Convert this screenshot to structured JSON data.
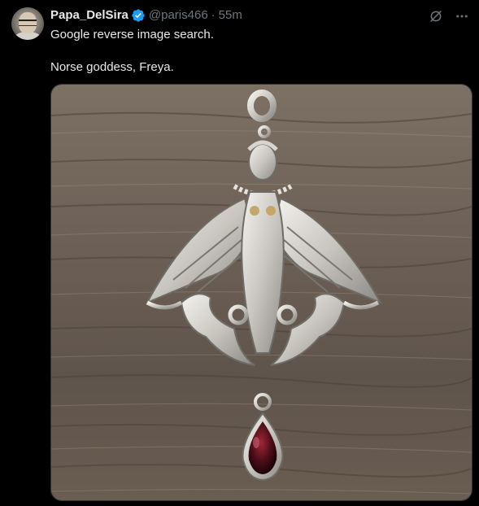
{
  "author": {
    "display_name": "Papa_DelSira",
    "handle": "@paris466",
    "separator": "·",
    "time": "55m",
    "verified": true,
    "verified_color": "#1d9bf0"
  },
  "tweet": {
    "lines": [
      "Google reverse image search.",
      "Norse goddess, Freya."
    ]
  },
  "actions": {
    "grok_icon": "grok-icon",
    "more_icon": "more-icon"
  },
  "media": {
    "description_icon": "photo",
    "alt": "Silver pendant of a winged goddess with cats and a dark red teardrop stone on weathered wood"
  },
  "colors": {
    "background": "#000000",
    "text_primary": "#e7e9ea",
    "text_secondary": "#71767b",
    "accent": "#1d9bf0"
  }
}
